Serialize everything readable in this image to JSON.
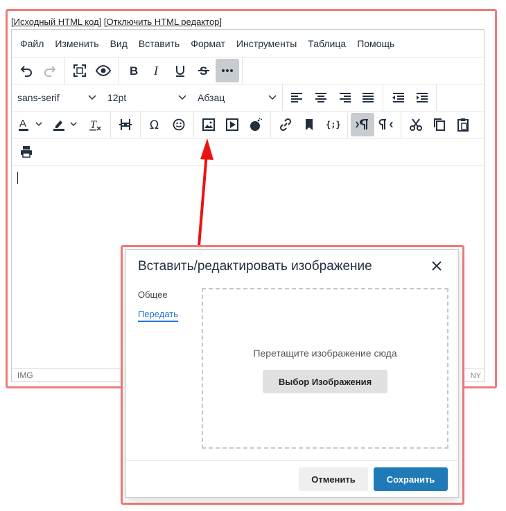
{
  "top_links": {
    "source_html": "[Исходный HTML код]",
    "disable_editor": "[Отключить HTML редактор]"
  },
  "menubar": {
    "items": [
      "Файл",
      "Изменить",
      "Вид",
      "Вставить",
      "Формат",
      "Инструменты",
      "Таблица",
      "Помощь"
    ]
  },
  "toolbar": {
    "font_family": "sans-serif",
    "font_size": "12pt",
    "block_format": "Абзац",
    "icons": [
      "undo-icon",
      "redo-icon",
      "fullscreen-icon",
      "preview-icon",
      "bold-icon",
      "italic-icon",
      "underline-icon",
      "strikethrough-icon",
      "more-icon",
      "align-left-icon",
      "align-center-icon",
      "align-right-icon",
      "align-justify-icon",
      "outdent-icon",
      "indent-icon",
      "text-color-icon",
      "highlight-color-icon",
      "clear-formatting-icon",
      "page-break-icon",
      "special-char-icon",
      "emoji-icon",
      "image-icon",
      "media-icon",
      "bomb-icon",
      "link-icon",
      "bookmark-icon",
      "code-icon",
      "ltr-icon",
      "rtl-icon",
      "cut-icon",
      "copy-icon",
      "paste-icon",
      "print-icon"
    ]
  },
  "statusbar": {
    "path": "IMG",
    "right_text": "NY"
  },
  "modal": {
    "title": "Вставить/редактировать изображение",
    "tabs": [
      "Общее",
      "Передать"
    ],
    "active_tab": "Передать",
    "dropzone_text": "Перетащите изображение сюда",
    "choose_button": "Выбор Изображения",
    "cancel_button": "Отменить",
    "save_button": "Сохранить"
  },
  "colors": {
    "highlight_frame": "#ef7b7b",
    "arrow": "#ee1111",
    "primary": "#207ab7",
    "link": "#2276d2",
    "active_button": "#c8cbcf"
  }
}
